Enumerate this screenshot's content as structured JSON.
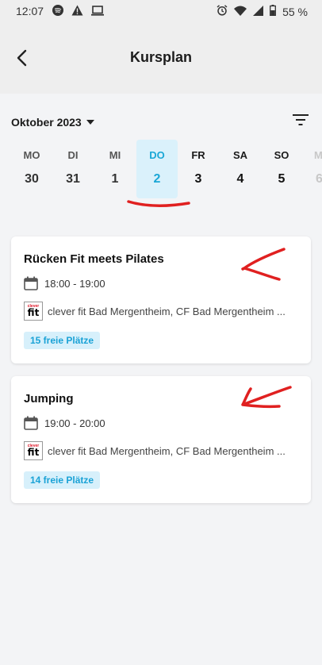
{
  "status_bar": {
    "time": "12:07",
    "battery": "55 %",
    "left_icons": [
      "spotify-icon",
      "warning-icon",
      "laptop-icon"
    ],
    "right_icons": [
      "alarm-icon",
      "wifi-icon",
      "signal-icon",
      "battery-icon"
    ]
  },
  "header": {
    "title": "Kursplan"
  },
  "calendar": {
    "month_label": "Oktober 2023",
    "days": [
      {
        "name": "MO",
        "date": "30",
        "state": "past"
      },
      {
        "name": "DI",
        "date": "31",
        "state": "past"
      },
      {
        "name": "MI",
        "date": "1",
        "state": "past"
      },
      {
        "name": "DO",
        "date": "2",
        "state": "selected"
      },
      {
        "name": "FR",
        "date": "3",
        "state": "future"
      },
      {
        "name": "SA",
        "date": "4",
        "state": "future"
      },
      {
        "name": "SO",
        "date": "5",
        "state": "future"
      },
      {
        "name": "M",
        "date": "6",
        "state": "faded"
      }
    ]
  },
  "courses": [
    {
      "title": "Rücken Fit meets Pilates",
      "time": "18:00 - 19:00",
      "location": "clever fit Bad Mergentheim, CF Bad Mergentheim ...",
      "spots": "15 freie Plätze"
    },
    {
      "title": "Jumping",
      "time": "19:00 - 20:00",
      "location": "clever fit Bad Mergentheim, CF Bad Mergentheim ...",
      "spots": "14 freie Plätze"
    }
  ],
  "logo": {
    "top": "clever",
    "bottom": "fit"
  },
  "colors": {
    "accent": "#1aa7d6",
    "selected_bg": "#daf1fb",
    "annotation": "#e02020"
  }
}
